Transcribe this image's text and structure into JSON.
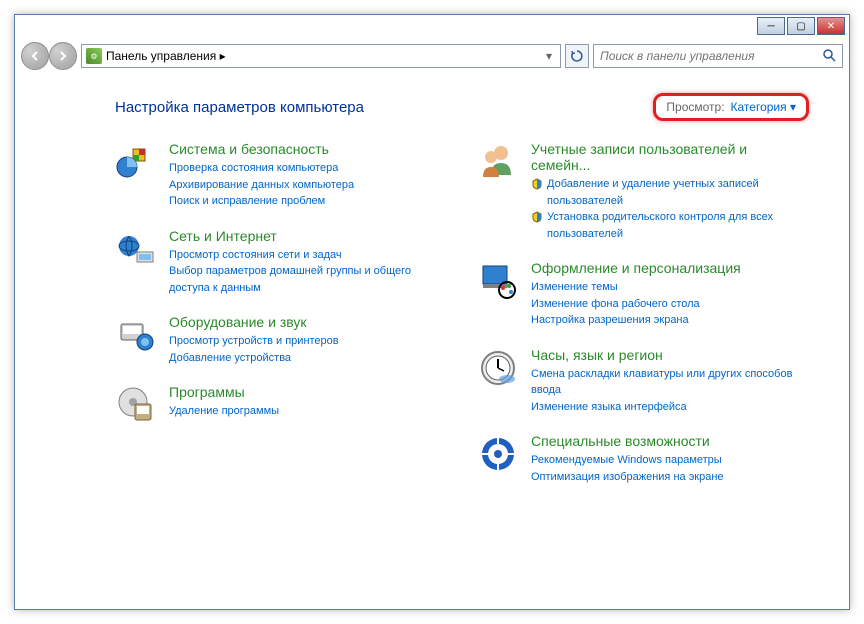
{
  "addressBar": {
    "text": "Панель управления  ▸",
    "dropdownGlyph": "▾"
  },
  "search": {
    "placeholder": "Поиск в панели управления"
  },
  "heading": "Настройка параметров компьютера",
  "viewSelector": {
    "label": "Просмотр:",
    "value": "Категория"
  },
  "leftColumn": [
    {
      "title": "Система и безопасность",
      "links": [
        {
          "text": "Проверка состояния компьютера"
        },
        {
          "text": "Архивирование данных компьютера"
        },
        {
          "text": "Поиск и исправление проблем"
        }
      ]
    },
    {
      "title": "Сеть и Интернет",
      "links": [
        {
          "text": "Просмотр состояния сети и задач"
        },
        {
          "text": "Выбор параметров домашней группы и общего доступа к данным"
        }
      ]
    },
    {
      "title": "Оборудование и звук",
      "links": [
        {
          "text": "Просмотр устройств и принтеров"
        },
        {
          "text": "Добавление устройства"
        }
      ]
    },
    {
      "title": "Программы",
      "links": [
        {
          "text": "Удаление программы"
        }
      ]
    }
  ],
  "rightColumn": [
    {
      "title": "Учетные записи пользователей и семейн...",
      "links": [
        {
          "text": "Добавление и удаление учетных записей пользователей",
          "shield": true
        },
        {
          "text": "Установка родительского контроля для всех пользователей",
          "shield": true
        }
      ]
    },
    {
      "title": "Оформление и персонализация",
      "links": [
        {
          "text": "Изменение темы"
        },
        {
          "text": "Изменение фона рабочего стола"
        },
        {
          "text": "Настройка разрешения экрана"
        }
      ]
    },
    {
      "title": "Часы, язык и регион",
      "links": [
        {
          "text": "Смена раскладки клавиатуры или других способов ввода"
        },
        {
          "text": "Изменение языка интерфейса"
        }
      ]
    },
    {
      "title": "Специальные возможности",
      "links": [
        {
          "text": "Рекомендуемые Windows параметры"
        },
        {
          "text": "Оптимизация изображения на экране"
        }
      ]
    }
  ]
}
